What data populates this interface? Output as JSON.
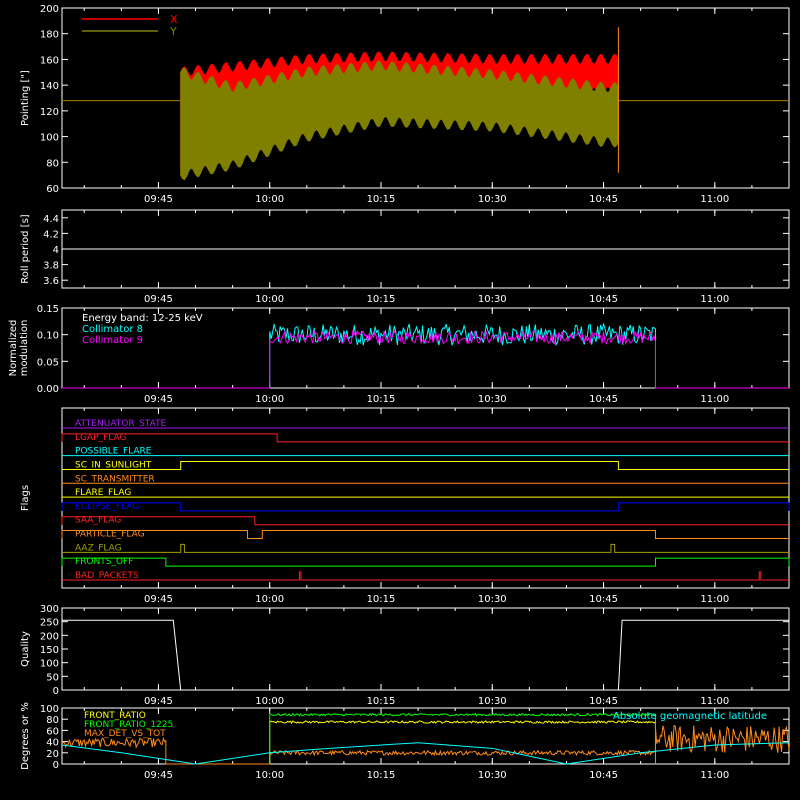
{
  "time_ticks": [
    "09:45",
    "10:00",
    "10:15",
    "10:30",
    "10:45",
    "11:00"
  ],
  "colors": {
    "background": "#000000",
    "axes": "#ffffff",
    "x": "#ff0000",
    "y": "#808000",
    "cyan": "#00ffff",
    "magenta": "#ff00ff",
    "green": "#00ff00",
    "yellow": "#ffff00",
    "orange": "#ff8c1a",
    "blue": "#0000ff",
    "purple": "#a020f0",
    "red": "#ff2020",
    "olive": "#a0a000"
  },
  "chart_data": [
    {
      "id": "pointing",
      "type": "line",
      "ylabel": "Pointing [\"]",
      "ylim": [
        60,
        200
      ],
      "yticks": [
        60,
        80,
        100,
        120,
        140,
        160,
        180,
        200
      ],
      "legend": [
        {
          "name": "X",
          "color": "#ff0000"
        },
        {
          "name": "Y",
          "color": "#808000"
        }
      ],
      "x_range": [
        "09:32",
        "11:10"
      ],
      "series": [
        {
          "name": "X",
          "color": "#ff0000",
          "baseline": 128,
          "active": [
            "09:48",
            "10:47"
          ],
          "upper_envelope": [
            [
              "09:48",
              150
            ],
            [
              "09:55",
              154
            ],
            [
              "10:05",
              160
            ],
            [
              "10:15",
              162
            ],
            [
              "10:30",
              160
            ],
            [
              "10:45",
              160
            ]
          ],
          "lower_envelope": [
            [
              "09:48",
              70
            ],
            [
              "09:55",
              80
            ],
            [
              "10:05",
              110
            ],
            [
              "10:15",
              120
            ],
            [
              "10:30",
              128
            ],
            [
              "10:45",
              135
            ]
          ]
        },
        {
          "name": "Y",
          "color": "#808000",
          "baseline": 128,
          "active": [
            "09:48",
            "10:47"
          ],
          "upper_envelope": [
            [
              "09:48",
              150
            ],
            [
              "09:55",
              138
            ],
            [
              "10:05",
              150
            ],
            [
              "10:15",
              155
            ],
            [
              "10:30",
              148
            ],
            [
              "10:45",
              138
            ]
          ],
          "lower_envelope": [
            [
              "09:48",
              70
            ],
            [
              "09:55",
              78
            ],
            [
              "10:05",
              100
            ],
            [
              "10:15",
              112
            ],
            [
              "10:30",
              108
            ],
            [
              "10:45",
              96
            ]
          ]
        }
      ]
    },
    {
      "id": "roll",
      "type": "line",
      "ylabel": "Roll period [s]",
      "ylim": [
        3.5,
        4.5
      ],
      "yticks": [
        3.6,
        3.8,
        4.0,
        4.2,
        4.4
      ],
      "series": [
        {
          "name": "roll",
          "color": "#ffffff",
          "values": [
            [
              "09:32",
              4.0
            ],
            [
              "11:10",
              4.0
            ]
          ]
        }
      ]
    },
    {
      "id": "modulation",
      "type": "line",
      "ylabel": "Normalized modulation",
      "ylim": [
        0,
        0.15
      ],
      "yticks": [
        "0.00",
        "0.05",
        "0.10",
        "0.15"
      ],
      "annotations": [
        "Energy band: 12-25 keV",
        "Collimator 8",
        "Collimator 9"
      ],
      "active": [
        "10:00",
        "10:52"
      ],
      "series": [
        {
          "name": "Collimator 8",
          "color": "#00ffff",
          "level": 0.1,
          "spread": 0.02
        },
        {
          "name": "Collimator 9",
          "color": "#ff00ff",
          "level": 0.095,
          "spread": 0.012
        }
      ]
    },
    {
      "id": "flags",
      "type": "line",
      "ylabel": "Flags",
      "flags": [
        {
          "label": "ATTENUATOR_STATE",
          "color": "#a020f0",
          "high": []
        },
        {
          "label": "LGAP_FLAG",
          "color": "#ff2020",
          "high": [
            [
              "09:32",
              "10:01"
            ]
          ]
        },
        {
          "label": "POSSIBLE_FLARE",
          "color": "#00ffff",
          "high": []
        },
        {
          "label": "SC_IN_SUNLIGHT",
          "color": "#ffff00",
          "high": [
            [
              "09:48",
              "10:47"
            ]
          ]
        },
        {
          "label": "SC_TRANSMITTER",
          "color": "#ff8c1a",
          "high": []
        },
        {
          "label": "FLARE_FLAG",
          "color": "#ffff00",
          "high": []
        },
        {
          "label": "ECLIPSE_FLAG",
          "color": "#0000ff",
          "high": [
            [
              "09:32",
              "09:48"
            ],
            [
              "10:47",
              "11:10"
            ]
          ]
        },
        {
          "label": "SAA_FLAG",
          "color": "#ff2020",
          "high": [
            [
              "09:32",
              "09:58"
            ]
          ]
        },
        {
          "label": "PARTICLE_FLAG",
          "color": "#ff8c1a",
          "high": [
            [
              "09:32",
              "09:57"
            ],
            [
              "09:59",
              "10:52"
            ]
          ]
        },
        {
          "label": "AAZ_FLAG",
          "color": "#a0a000",
          "high": [
            [
              "09:48",
              "09:48.5"
            ],
            [
              "10:46",
              "10:46.5"
            ]
          ]
        },
        {
          "label": "FRONTS_OFF",
          "color": "#00ff00",
          "high": [
            [
              "09:32",
              "09:46"
            ],
            [
              "10:52",
              "11:10"
            ]
          ]
        },
        {
          "label": "BAD_PACKETS",
          "color": "#ff2020",
          "high": [
            [
              "10:04",
              "10:04.2"
            ],
            [
              "11:06",
              "11:06.2"
            ]
          ]
        }
      ]
    },
    {
      "id": "quality",
      "type": "line",
      "ylabel": "Quality",
      "ylim": [
        0,
        300
      ],
      "yticks": [
        0,
        50,
        100,
        150,
        200,
        250,
        300
      ],
      "series": [
        {
          "name": "quality",
          "color": "#ffffff",
          "values": [
            [
              "09:32",
              255
            ],
            [
              "09:47",
              255
            ],
            [
              "09:48",
              0
            ],
            [
              "10:47",
              0
            ],
            [
              "10:47.5",
              255
            ],
            [
              "11:10",
              255
            ]
          ]
        }
      ]
    },
    {
      "id": "ratios",
      "type": "line",
      "ylabel": "Degrees or %",
      "ylim": [
        0,
        100
      ],
      "yticks": [
        0,
        20,
        40,
        60,
        80,
        100
      ],
      "annotations": [
        "Absolute geomagnetic latitude"
      ],
      "legend": [
        {
          "name": "FRONT_RATIO",
          "color": "#ffff00"
        },
        {
          "name": "FRONT_RATIO_1225",
          "color": "#00ff00"
        },
        {
          "name": "MAX_DET_VS_TOT",
          "color": "#ff8c1a"
        }
      ],
      "series": [
        {
          "name": "FRONT_RATIO",
          "color": "#ffff00",
          "active": [
            "10:00",
            "10:52"
          ],
          "level": 75,
          "spread": 2
        },
        {
          "name": "FRONT_RATIO_1225",
          "color": "#00ff00",
          "active": [
            "10:00",
            "10:52"
          ],
          "level": 88,
          "spread": 2
        },
        {
          "name": "MAX_DET_VS_TOT",
          "color": "#ff8c1a",
          "segments": [
            {
              "range": [
                "09:32",
                "09:46"
              ],
              "level": 38,
              "spread": 8
            },
            {
              "range": [
                "10:00",
                "10:52"
              ],
              "level": 20,
              "spread": 4
            },
            {
              "range": [
                "10:52",
                "11:10"
              ],
              "level": 45,
              "spread": 25
            }
          ]
        },
        {
          "name": "Absolute geomagnetic latitude",
          "color": "#00ffff",
          "values": [
            [
              "09:32",
              34
            ],
            [
              "09:40",
              20
            ],
            [
              "09:50",
              0
            ],
            [
              "10:00",
              20
            ],
            [
              "10:08",
              28
            ],
            [
              "10:20",
              38
            ],
            [
              "10:30",
              28
            ],
            [
              "10:40",
              0
            ],
            [
              "10:50",
              20
            ],
            [
              "11:00",
              34
            ],
            [
              "11:10",
              38
            ]
          ]
        }
      ]
    }
  ]
}
